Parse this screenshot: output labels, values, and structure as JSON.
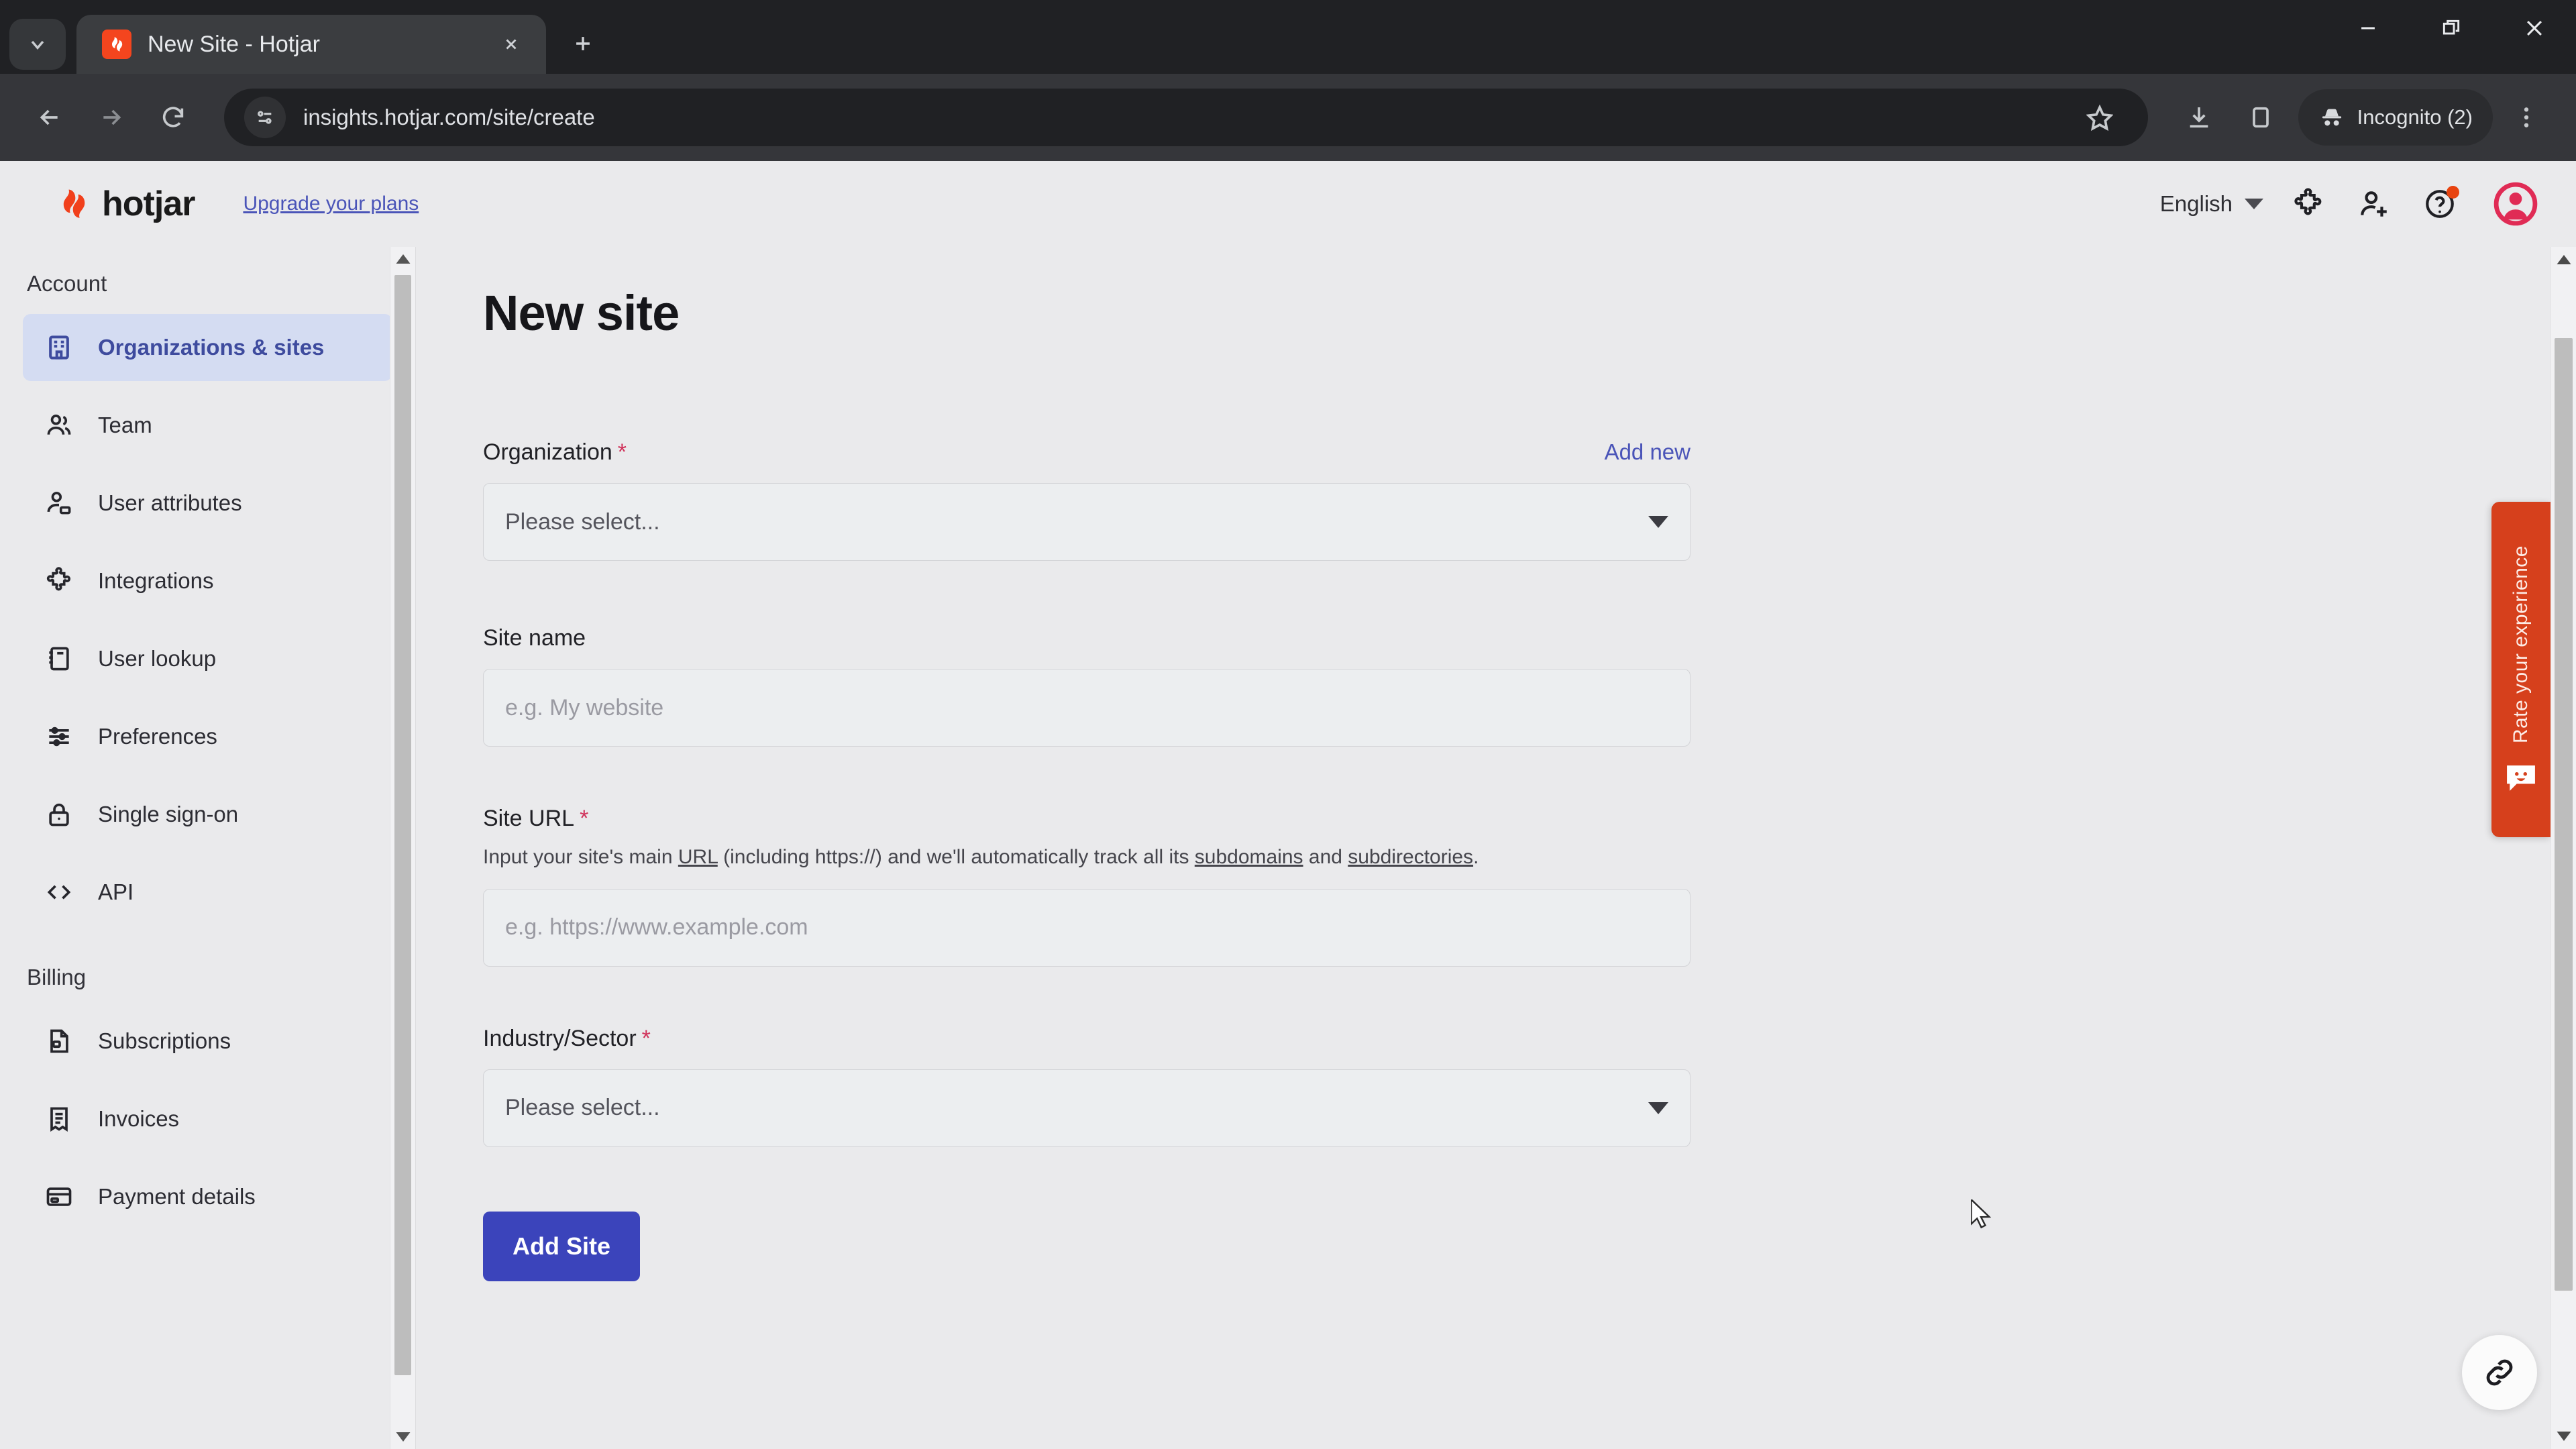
{
  "browser": {
    "tab": {
      "title": "New Site - Hotjar",
      "favicon": "hotjar-favicon"
    },
    "tab_search_icon": "chevron-down-icon",
    "new_tab_icon": "plus-icon",
    "close_tab_icon": "close-icon",
    "nav": {
      "back_icon": "arrow-left-icon",
      "forward_icon": "arrow-right-icon",
      "reload_icon": "reload-icon"
    },
    "omnibox": {
      "url": "insights.hotjar.com/site/create",
      "site_info_icon": "page-settings-icon",
      "bookmark_icon": "star-icon"
    },
    "actions": {
      "download_icon": "download-icon",
      "side_panel_icon": "side-panel-icon",
      "menu_icon": "three-dot-menu-icon"
    },
    "incognito": {
      "label": "Incognito (2)",
      "icon": "incognito-hat-icon"
    },
    "window_controls": {
      "minimize": "minimize-icon",
      "restore": "restore-icon",
      "close": "close-window-icon"
    }
  },
  "app": {
    "header": {
      "brand": "hotjar",
      "brand_mark": "hotjar-flame-logo",
      "upgrade_link": "Upgrade your plans",
      "language": "English",
      "language_caret": "chevron-down-icon",
      "integrations_icon": "puzzle-piece-icon",
      "invite_user_icon": "add-user-icon",
      "help_icon": "question-circle-icon",
      "help_badge": true,
      "avatar_icon": "user-avatar-icon",
      "avatar_color": "#e02b55"
    },
    "sidebar": {
      "sections": [
        {
          "title": "Account",
          "items": [
            {
              "label": "Organizations & sites",
              "icon": "building-icon",
              "active": true
            },
            {
              "label": "Team",
              "icon": "people-icon",
              "active": false
            },
            {
              "label": "User attributes",
              "icon": "user-tag-icon",
              "active": false
            },
            {
              "label": "Integrations",
              "icon": "puzzle-piece-icon",
              "active": false
            },
            {
              "label": "User lookup",
              "icon": "notebook-icon",
              "active": false
            },
            {
              "label": "Preferences",
              "icon": "sliders-icon",
              "active": false
            },
            {
              "label": "Single sign-on",
              "icon": "lock-icon",
              "active": false
            },
            {
              "label": "API",
              "icon": "code-brackets-icon",
              "active": false
            }
          ]
        },
        {
          "title": "Billing",
          "items": [
            {
              "label": "Subscriptions",
              "icon": "document-lock-icon",
              "active": false
            },
            {
              "label": "Invoices",
              "icon": "receipt-icon",
              "active": false
            },
            {
              "label": "Payment details",
              "icon": "credit-card-icon",
              "active": false
            }
          ]
        }
      ],
      "active_bg": "#d4dcf2",
      "active_fg": "#3e4b9e"
    },
    "main": {
      "page_title": "New site",
      "fields": {
        "organization": {
          "label": "Organization",
          "required_marker": "*",
          "add_new_label": "Add new",
          "select_value": "Please select...",
          "caret_icon": "caret-down-icon"
        },
        "site_name": {
          "label": "Site name",
          "placeholder": "e.g. My website",
          "value": ""
        },
        "site_url": {
          "label": "Site URL",
          "required_marker": "*",
          "help_prefix": "Input your site's main ",
          "help_link_url": "URL",
          "help_mid": " (including https://) and we'll automatically track all its ",
          "help_link_subdomains": "subdomains",
          "help_and": " and ",
          "help_link_subdirectories": "subdirectories",
          "help_suffix": ".",
          "placeholder": "e.g. https://www.example.com",
          "value": ""
        },
        "industry": {
          "label": "Industry/Sector",
          "required_marker": "*",
          "select_value": "Please select...",
          "caret_icon": "caret-down-icon"
        }
      },
      "submit_button": {
        "label": "Add Site",
        "color": "#3b44bb"
      },
      "rate_tab": {
        "label": "Rate your experience",
        "icon": "smiley-chat-icon",
        "color": "#d6401c"
      },
      "link_fab": {
        "icon": "chain-link-icon"
      }
    }
  }
}
